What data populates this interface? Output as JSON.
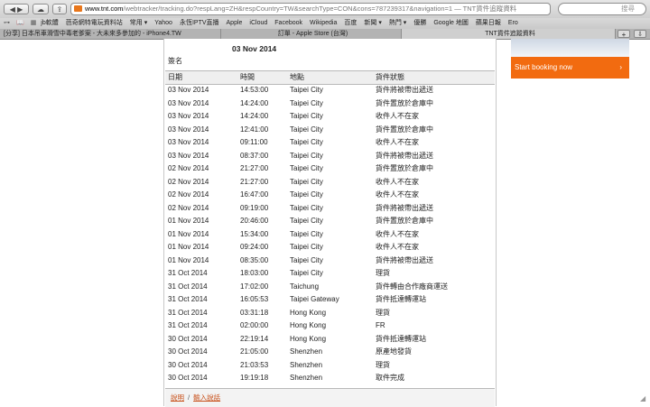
{
  "browser": {
    "url_host": "www.tnt.com",
    "url_path": "/webtracker/tracking.do?respLang=ZH&respCountry=TW&searchType=CON&cons=787239317&navigation=1",
    "page_title_suffix": " — TNT貨件追蹤資料",
    "search_placeholder": "搜尋",
    "bookmarks": [
      "jb軟體",
      "芭奇網特電玩資料站",
      "常用 ▾",
      "Yahoo",
      "永恆IPTV直播",
      "Apple",
      "iCloud",
      "Facebook",
      "Wikipedia",
      "百度",
      "新聞 ▾",
      "熱門 ▾",
      "優勝",
      "Google 地圖",
      "蘋果日報",
      "Ero"
    ],
    "tabs": [
      {
        "label": "[分享] 日本吊車滑雪中毒老爹案 - 大未來多參加的 - iPhone4.TW",
        "active": false
      },
      {
        "label": "訂單 - Apple Store (台灣)",
        "active": false
      },
      {
        "label": "TNT貨件追蹤資料",
        "active": true
      }
    ],
    "tab_add": "+"
  },
  "tracking": {
    "date_header": "03 Nov 2014",
    "signature_label": "簽名",
    "columns": [
      "日期",
      "時間",
      "地點",
      "貨件狀態"
    ],
    "rows": [
      [
        "03 Nov 2014",
        "14:53:00",
        "Taipei City",
        "貨件將被帶出遞送"
      ],
      [
        "03 Nov 2014",
        "14:24:00",
        "Taipei City",
        "貨件置放於倉庫中"
      ],
      [
        "03 Nov 2014",
        "14:24:00",
        "Taipei City",
        "收件人不在家"
      ],
      [
        "03 Nov 2014",
        "12:41:00",
        "Taipei City",
        "貨件置放於倉庫中"
      ],
      [
        "03 Nov 2014",
        "09:11:00",
        "Taipei City",
        "收件人不在家"
      ],
      [
        "03 Nov 2014",
        "08:37:00",
        "Taipei City",
        "貨件將被帶出遞送"
      ],
      [
        "02 Nov 2014",
        "21:27:00",
        "Taipei City",
        "貨件置放於倉庫中"
      ],
      [
        "02 Nov 2014",
        "21:27:00",
        "Taipei City",
        "收件人不在家"
      ],
      [
        "02 Nov 2014",
        "16:47:00",
        "Taipei City",
        "收件人不在家"
      ],
      [
        "02 Nov 2014",
        "09:19:00",
        "Taipei City",
        "貨件將被帶出遞送"
      ],
      [
        "01 Nov 2014",
        "20:46:00",
        "Taipei City",
        "貨件置放於倉庫中"
      ],
      [
        "01 Nov 2014",
        "15:34:00",
        "Taipei City",
        "收件人不在家"
      ],
      [
        "01 Nov 2014",
        "09:24:00",
        "Taipei City",
        "收件人不在家"
      ],
      [
        "01 Nov 2014",
        "08:35:00",
        "Taipei City",
        "貨件將被帶出遞送"
      ],
      [
        "31 Oct 2014",
        "18:03:00",
        "Taipei City",
        "理貨"
      ],
      [
        "31 Oct 2014",
        "17:02:00",
        "Taichung",
        "貨件轉由合作廠商運送"
      ],
      [
        "31 Oct 2014",
        "16:05:53",
        "Taipei Gateway",
        "貨件抵達轉運站"
      ],
      [
        "31 Oct 2014",
        "03:31:18",
        "Hong Kong",
        "理貨"
      ],
      [
        "31 Oct 2014",
        "02:00:00",
        "Hong Kong",
        "FR"
      ],
      [
        "30 Oct 2014",
        "22:19:14",
        "Hong Kong",
        "貨件抵達轉運站"
      ],
      [
        "30 Oct 2014",
        "21:05:00",
        "Shenzhen",
        "原產地發貨"
      ],
      [
        "30 Oct 2014",
        "21:03:53",
        "Shenzhen",
        "理貨"
      ],
      [
        "30 Oct 2014",
        "19:19:18",
        "Shenzhen",
        "取件完成"
      ]
    ],
    "footer_links": [
      "說明",
      "輸入說話"
    ],
    "footer_sep": "/"
  },
  "banner": {
    "button_label": "Start booking now",
    "arrow": "›"
  }
}
